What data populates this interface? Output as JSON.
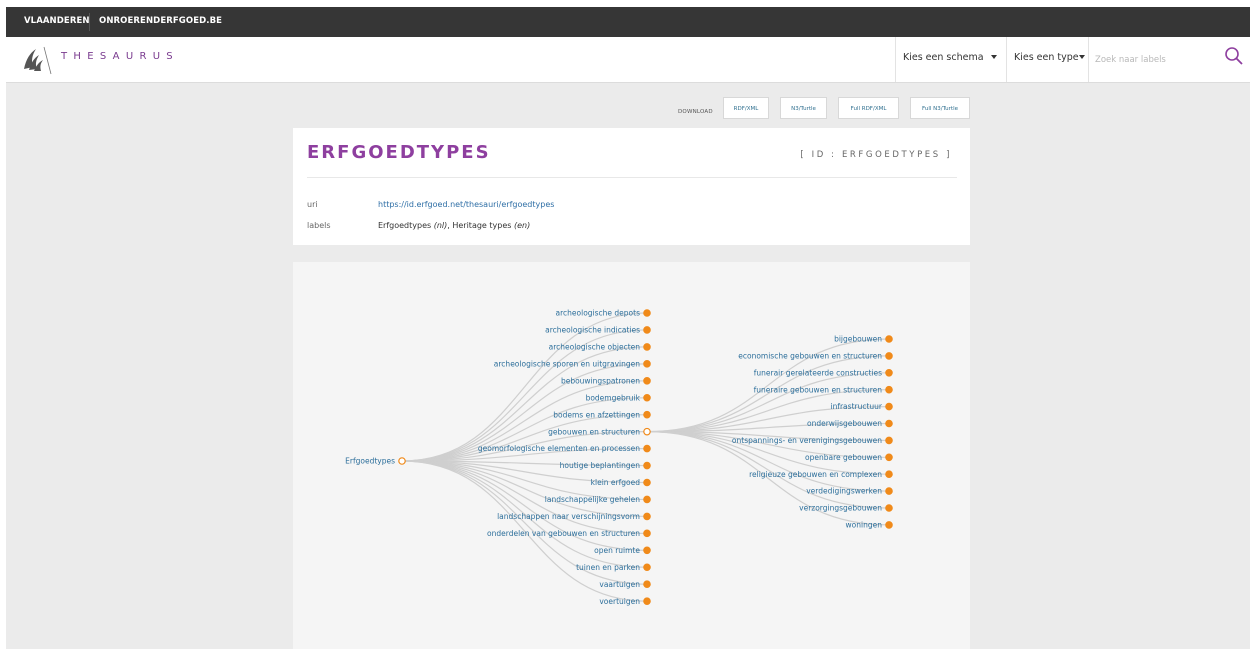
{
  "topbar": {
    "links": [
      "VLAANDEREN",
      "ONROERENDERFGOED.BE"
    ]
  },
  "header": {
    "brand": "THESAURUS",
    "schema_dropdown": "Kies een schema",
    "type_dropdown": "Kies een type",
    "search_placeholder": "Zoek naar labels"
  },
  "download": {
    "label": "DOWNLOAD",
    "buttons": [
      "RDF/XML",
      "N3/Turtle",
      "Full RDF/XML",
      "Full N3/Turtle"
    ]
  },
  "concept": {
    "title": "ERFGOEDTYPES",
    "id_label": "[ ID : ERFGOEDTYPES ]",
    "uri_key": "uri",
    "uri_value": "https://id.erfgoed.net/thesauri/erfgoedtypes",
    "labels_key": "labels",
    "label1": "Erfgoedtypes",
    "lang1": "(nl)",
    "label2": "Heritage types",
    "lang2": "(en)"
  },
  "tree": {
    "root": "Erfgoedtypes",
    "children": [
      "archeologische depots",
      "archeologische indicaties",
      "archeologische objecten",
      "archeologische sporen en uitgravingen",
      "bebouwingspatronen",
      "bodemgebruik",
      "bodems en afzettingen",
      "gebouwen en structuren",
      "geomorfologische elementen en processen",
      "houtige beplantingen",
      "klein erfgoed",
      "landschappelijke gehelen",
      "landschappen naar verschijningsvorm",
      "onderdelen van gebouwen en structuren",
      "open ruimte",
      "tuinen en parken",
      "vaartuigen",
      "voertuigen"
    ],
    "expanded": "gebouwen en structuren",
    "grandchildren": [
      "bijgebouwen",
      "economische gebouwen en structuren",
      "funerair gerelateerde constructies",
      "funeraire gebouwen en structuren",
      "infrastructuur",
      "onderwijsgebouwen",
      "ontspannings- en verenigingsgebouwen",
      "openbare gebouwen",
      "religieuze gebouwen en complexen",
      "verdedigingswerken",
      "verzorgingsgebouwen",
      "woningen"
    ],
    "colors": {
      "leaf": "#f08a1a",
      "link": "#cfcfcf",
      "label": "#2d6f9b"
    }
  }
}
